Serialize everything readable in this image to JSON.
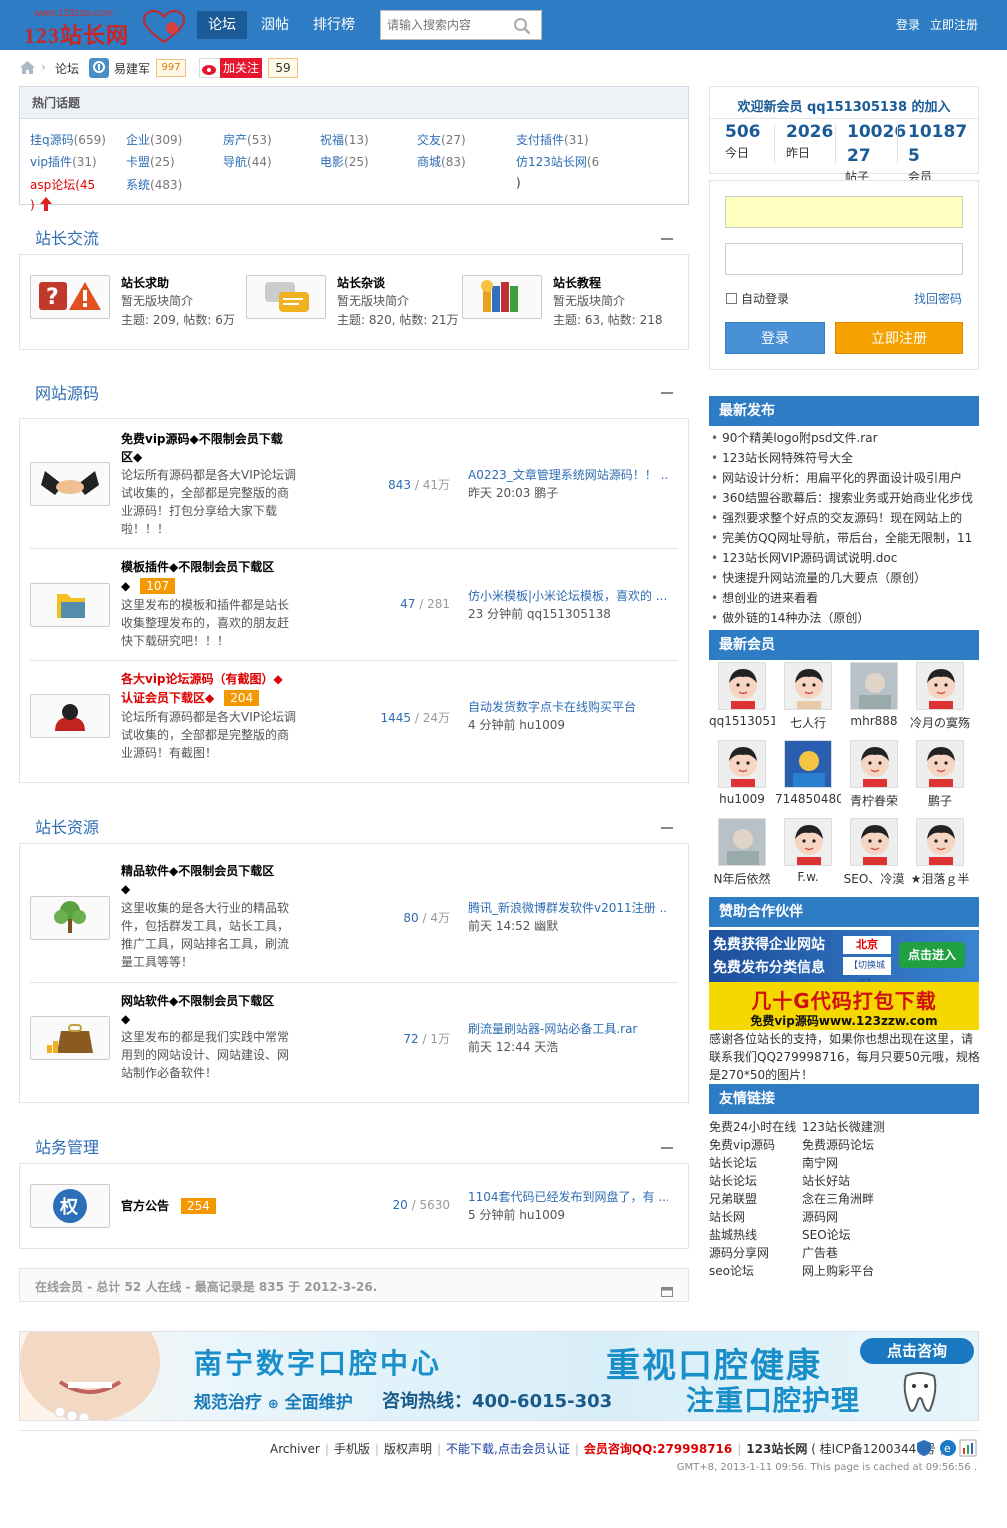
{
  "header": {
    "logo_url": "www.123zzw.com",
    "logo_name": "123站长网",
    "nav": [
      "论坛",
      "洇帖",
      "排行榜"
    ],
    "search_placeholder": "请输入搜索内容",
    "login": "登录",
    "register": "立即注册"
  },
  "breadcrumb": {
    "item": "论坛",
    "user": "易建军",
    "user_count": "997",
    "follow": "加关注",
    "follow_count": "59"
  },
  "hot": {
    "title": "热门话题",
    "tags": [
      {
        "name": "挂q源码",
        "count": "(659)"
      },
      {
        "name": "企业",
        "count": "(309)"
      },
      {
        "name": "房产",
        "count": "(53)"
      },
      {
        "name": "祝福",
        "count": "(13)"
      },
      {
        "name": "交友",
        "count": "(27)"
      },
      {
        "name": "支付插件",
        "count": "(31)"
      },
      {
        "name": "vip插件",
        "count": "(31)"
      },
      {
        "name": "卡盟",
        "count": "(25)"
      },
      {
        "name": "导航",
        "count": "(44)"
      },
      {
        "name": "电影",
        "count": "(25)"
      },
      {
        "name": "商城",
        "count": "(83)"
      },
      {
        "name": "仿123站长网",
        "count": "(6"
      },
      {
        "name": "asp论坛",
        "count": "(45"
      },
      {
        "name": "系统",
        "count": "(483)"
      }
    ],
    "wrap1": ")",
    "wrap2": ")"
  },
  "sections": {
    "s1": {
      "title": "站长交流",
      "forums": [
        {
          "name": "站长求助",
          "desc": "暂无版块简介",
          "stats": "主题: 209, 帖数: 6万"
        },
        {
          "name": "站长杂谈",
          "desc": "暂无版块简介",
          "stats": "主题: 820, 帖数: 21万"
        },
        {
          "name": "站长教程",
          "desc": "暂无版块简介",
          "stats": "主题: 63, 帖数: 218"
        }
      ]
    },
    "s2": {
      "title": "网站源码",
      "forums": [
        {
          "name": "免费vip源码◆不限制会员下载",
          "name2": "区◆",
          "badge": "",
          "desc": [
            "论坛所有源码都是各大VIP论坛调",
            "试收集的，全部都是完整版的商",
            "业源码！打包分享给大家下载",
            "啦！！！"
          ],
          "count": "843",
          "total": " / 41万",
          "last_title": "A0223_文章管理系统网站源码！！ ...",
          "last_meta": "昨天 20:03 鹏子"
        },
        {
          "name": "模板插件◆不限制会员下载区",
          "name2": "◆",
          "badge": "107",
          "desc": [
            "这里发布的模板和插件都是站长",
            "收集整理发布的，喜欢的朋友赶",
            "快下载研究吧！！！"
          ],
          "count": "47",
          "total": " / 281",
          "last_title": "仿小米模板|小米论坛模板，喜欢的 ...",
          "last_meta": "23 分钟前 qq151305138"
        },
        {
          "name": "各大vip论坛源码（有截图）◆",
          "name2": "认证会员下载区◆",
          "badge": "204",
          "desc": [
            "论坛所有源码都是各大VIP论坛调",
            "试收集的，全部都是完整版的商",
            "业源码！有截图！"
          ],
          "count": "1445",
          "total": " / 24万",
          "last_title": "自动发货数字点卡在线购买平台",
          "last_meta": "4 分钟前 hu1009"
        }
      ]
    },
    "s3": {
      "title": "站长资源",
      "forums": [
        {
          "name": "精品软件◆不限制会员下载区",
          "name2": "◆",
          "desc": [
            "这里收集的是各大行业的精品软",
            "件，包括群发工具，站长工具，",
            "推广工具，网站排名工具，刷流",
            "量工具等等！"
          ],
          "count": "80",
          "total": " / 4万",
          "last_title": "腾讯_新浪微博群发软件v2011注册 ...",
          "last_meta": "前天 14:52 幽默"
        },
        {
          "name": "网站软件◆不限制会员下载区",
          "name2": "◆",
          "desc": [
            "这里发布的都是我们实践中常常",
            "用到的网站设计、网站建设、网",
            "站制作必备软件！"
          ],
          "count": "72",
          "total": " / 1万",
          "last_title": "刷流量刷站器-网站必备工具.rar",
          "last_meta": "前天 12:44 天浩"
        }
      ]
    },
    "s4": {
      "title": "站务管理",
      "forums": [
        {
          "name": "官方公告",
          "badge": "254",
          "count": "20",
          "total": " / 5630",
          "last_title": "1104套代码已经发布到网盘了，有 ...",
          "last_meta": "5 分钟前 hu1009"
        }
      ]
    }
  },
  "online": "在线会员 - 总计 52 人在线 - 最高记录是 835 于 2012-3-26.",
  "stats": {
    "welcome": "欢迎新会员 qq151305138 的加入",
    "today": "506",
    "today_label": "今日",
    "yesterday": "2026",
    "yesterday_label": "昨日",
    "posts_a": "10026",
    "posts_b": "27",
    "posts_label": "帖子",
    "members_a": "10187",
    "members_b": "5",
    "members_label": "会员"
  },
  "login_box": {
    "remember": "自动登录",
    "forgot": "找回密码",
    "login": "登录",
    "register": "立即注册"
  },
  "latest": {
    "title": "最新发布",
    "items": [
      "90个精美logo附psd文件.rar",
      "123站长网特殊符号大全",
      "网站设计分析：用扁平化的界面设计吸引用户",
      "360结盟谷歌幕后：搜索业务或开始商业化步伐",
      "强烈要求整个好点的交友源码！现在网站上的",
      "完美仿QQ网址导航，带后台，全能无限制，11",
      "123站长网VIP源码调试说明.doc",
      "快速提升网站流量的几大要点（原创）",
      "想创业的进来看看",
      "做外链的14种办法（原创）"
    ]
  },
  "members": {
    "title": "最新会员",
    "list": [
      "qq1513051",
      "七人行",
      "mhr888",
      "冷月の寞殇",
      "hu1009",
      "714850480",
      "青柠眷荣",
      "鹏子",
      "N年后依然",
      "F.w.",
      "SEO、冷漠",
      "★泪落ｇ半"
    ]
  },
  "sponsor": {
    "title": "赞助合作伙伴",
    "ad1_line1": "免费获得企业网站",
    "ad1_line2": "免费发布分类信息",
    "ad1_city": "北京",
    "ad1_switch": "【切换城市】",
    "ad1_btn": "点击进入",
    "ad2_line1": "几十G代码打包下载",
    "ad2_line2": "免费vip源码www.123zzw.com",
    "thanks": [
      "感谢各位站长的支持，如果你也想出现在这里，请",
      "联系我们QQ279998716，每月只要50元哦，规格",
      "是270*50的图片！"
    ]
  },
  "friends": {
    "title": "友情链接",
    "links": [
      "免费24小时在线",
      "123站长微建测",
      "免费vip源码",
      "免费源码论坛",
      "站长论坛",
      "南宁网",
      "站长论坛",
      "站长好站",
      "兄弟联盟",
      "念在三角洲畔",
      "站长网",
      "源码网",
      "盐城热线",
      "SEO论坛",
      "源码分享网",
      "广告巷",
      "seo论坛",
      "网上购彩平台"
    ]
  },
  "banner": {
    "left_title": "南宁数字口腔中心",
    "left_sub1": "规范治疗",
    "left_sub2": "全面维护",
    "hotline": "咨询热线：400-6015-303",
    "right_title": "重视口腔健康",
    "right_sub": "注重口腔护理",
    "consult": "点击咨询"
  },
  "footer": {
    "links": [
      "Archiver",
      "手机版",
      "版权声明"
    ],
    "red1": "不能下载,点击会员认证",
    "red2": "会员咨询QQ:279998716",
    "site": "123站长网",
    "icp": "( 桂ICP备12003440号 )",
    "time": "GMT+8, 2013-1-11 09:56. This page is cached at 09:56:56 ."
  },
  "colors": {
    "brand": "#2e7cc3",
    "accent": "#f39800",
    "link": "#2e6db4",
    "red": "#dd0000"
  }
}
